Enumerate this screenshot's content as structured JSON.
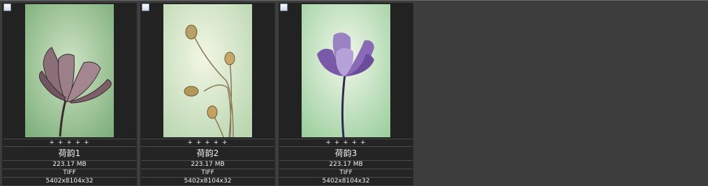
{
  "items": [
    {
      "stars": "+ + + + +",
      "name": "荷韵1",
      "size": "223.17 MB",
      "format": "TIFF",
      "dimensions": "5402x8104x32",
      "selected": false,
      "thumb_icon": "lotus-flower-image"
    },
    {
      "stars": "+ + + + +",
      "name": "荷韵2",
      "size": "223.17 MB",
      "format": "TIFF",
      "dimensions": "5402x8104x32",
      "selected": false,
      "thumb_icon": "lotus-seedpods-image"
    },
    {
      "stars": "+ + + + +",
      "name": "荷韵3",
      "size": "223.17 MB",
      "format": "TIFF",
      "dimensions": "5402x8104x32",
      "selected": false,
      "thumb_icon": "purple-lotus-image"
    }
  ],
  "colors": {
    "background": "#3d3d3d",
    "card": "#2b2b2b",
    "text": "#f2f2f2"
  }
}
